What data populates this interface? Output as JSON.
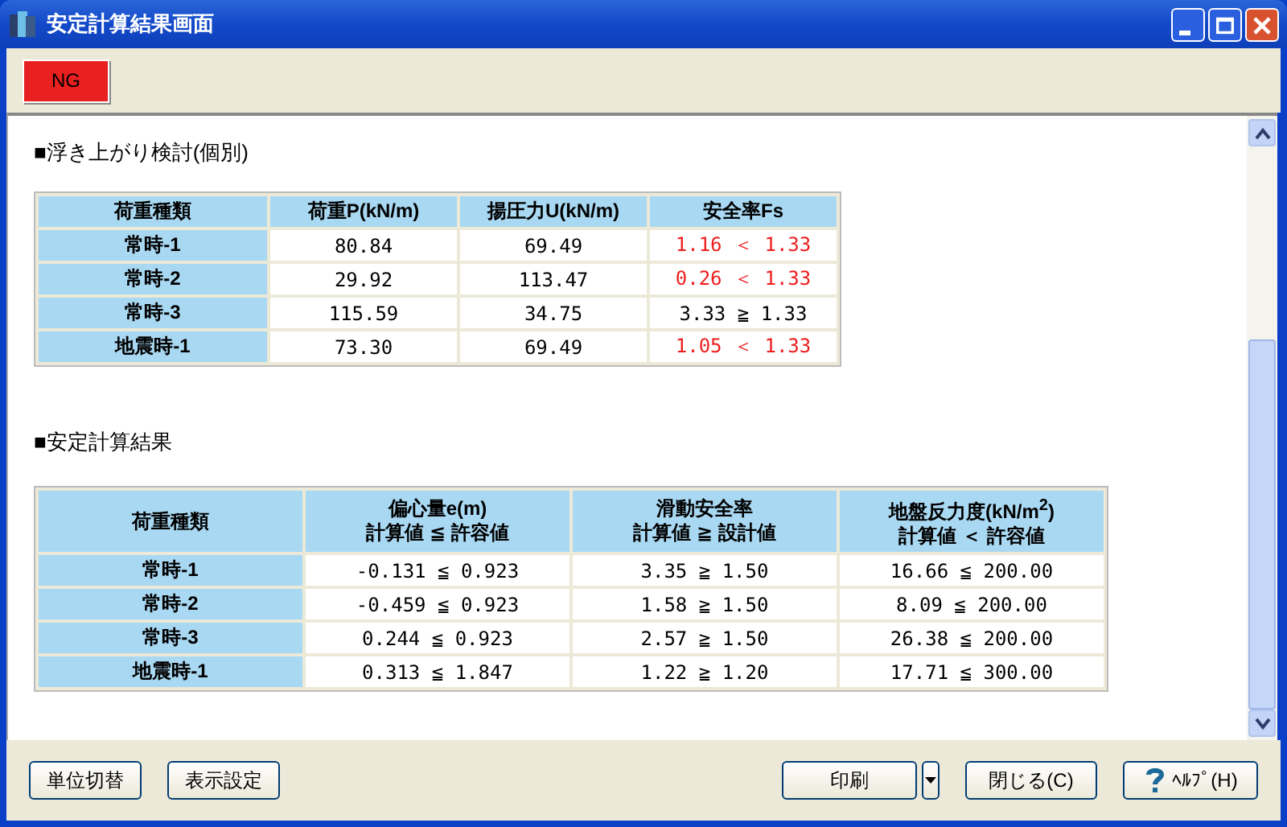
{
  "window": {
    "title": "安定計算結果画面"
  },
  "status_badge": {
    "label": "NG",
    "ng": true
  },
  "uplift": {
    "heading": "■浮き上がり検討(個別)",
    "columns": [
      "荷重種類",
      "荷重P(kN/m)",
      "揚圧力U(kN/m)",
      "安全率Fs"
    ],
    "rows": [
      {
        "case": "常時-1",
        "p": "80.84",
        "u": "69.49",
        "fs": "1.16 ＜ 1.33",
        "ng": true
      },
      {
        "case": "常時-2",
        "p": "29.92",
        "u": "113.47",
        "fs": "0.26 ＜ 1.33",
        "ng": true
      },
      {
        "case": "常時-3",
        "p": "115.59",
        "u": "34.75",
        "fs": "3.33 ≧ 1.33",
        "ng": false
      },
      {
        "case": "地震時-1",
        "p": "73.30",
        "u": "69.49",
        "fs": "1.05 ＜ 1.33",
        "ng": true
      }
    ]
  },
  "stability": {
    "heading": "■安定計算結果",
    "columns": [
      {
        "label": "荷重種類"
      },
      {
        "label": "偏心量e(m)",
        "sub": "計算値 ≦ 許容値"
      },
      {
        "label": "滑動安全率",
        "sub": "計算値 ≧ 設計値"
      },
      {
        "label": "地盤反力度(kN/m$^{2}$)",
        "sub": "計算値 ＜ 許容値"
      }
    ],
    "rows": [
      [
        "常時-1",
        "-0.131 ≦ 0.923",
        "3.35 ≧ 1.50",
        "16.66 ≦ 200.00"
      ],
      [
        "常時-2",
        "-0.459 ≦ 0.923",
        "1.58 ≧ 1.50",
        "8.09 ≦ 200.00"
      ],
      [
        "常時-3",
        "0.244 ≦ 0.923",
        "2.57 ≧ 1.50",
        "26.38 ≦ 200.00"
      ],
      [
        "地震時-1",
        "0.313 ≦ 1.847",
        "1.22 ≧ 1.20",
        "17.71 ≦ 300.00"
      ]
    ]
  },
  "buttons_left": [
    "単位切替",
    "表示設定"
  ],
  "print_button": "印刷",
  "close_button": "閉じる(C)",
  "help_button": "ﾍﾙﾌﾟ(H)"
}
